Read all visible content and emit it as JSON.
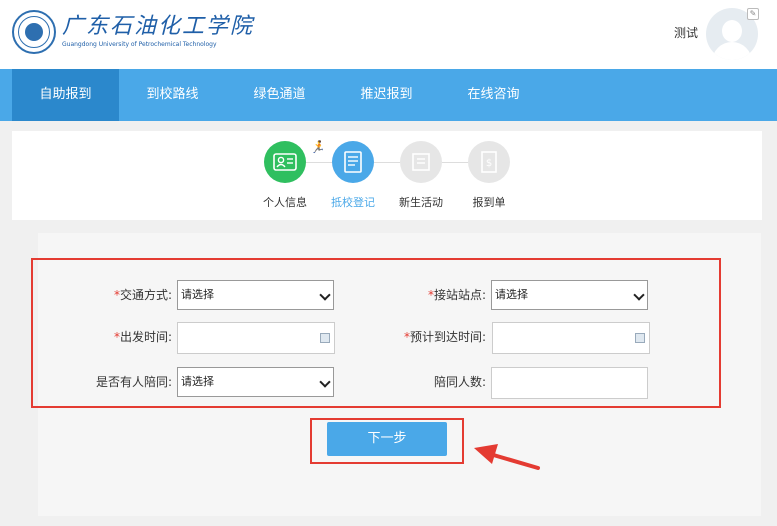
{
  "header": {
    "logo_cn": "广东石油化工学院",
    "logo_en": "Guangdong University of Petrochemical Technology",
    "user_name": "测试"
  },
  "nav": {
    "items": [
      "自助报到",
      "到校路线",
      "绿色通道",
      "推迟报到",
      "在线咨询"
    ],
    "active_index": 0
  },
  "steps": {
    "items": [
      {
        "label": "个人信息",
        "state": "done",
        "icon": "id-card-icon"
      },
      {
        "label": "抵校登记",
        "state": "active",
        "icon": "document-icon"
      },
      {
        "label": "新生活动",
        "state": "pending",
        "icon": "activity-icon"
      },
      {
        "label": "报到单",
        "state": "pending",
        "icon": "receipt-icon"
      }
    ]
  },
  "form": {
    "transport_label": "交通方式:",
    "transport_value": "请选择",
    "pickup_label": "接站站点:",
    "pickup_value": "请选择",
    "departure_label": "出发时间:",
    "departure_value": "",
    "arrival_label": "预计到达时间:",
    "arrival_value": "",
    "companion_label": "是否有人陪同:",
    "companion_value": "请选择",
    "companion_count_label": "陪同人数:",
    "companion_count_value": "",
    "required_mark": "*"
  },
  "actions": {
    "next_label": "下一步"
  },
  "colors": {
    "primary": "#4aa8e8",
    "nav_active": "#2b88cc",
    "done_step": "#2fbf5f",
    "pending_step": "#e6e6e6",
    "highlight": "#e43b32"
  }
}
